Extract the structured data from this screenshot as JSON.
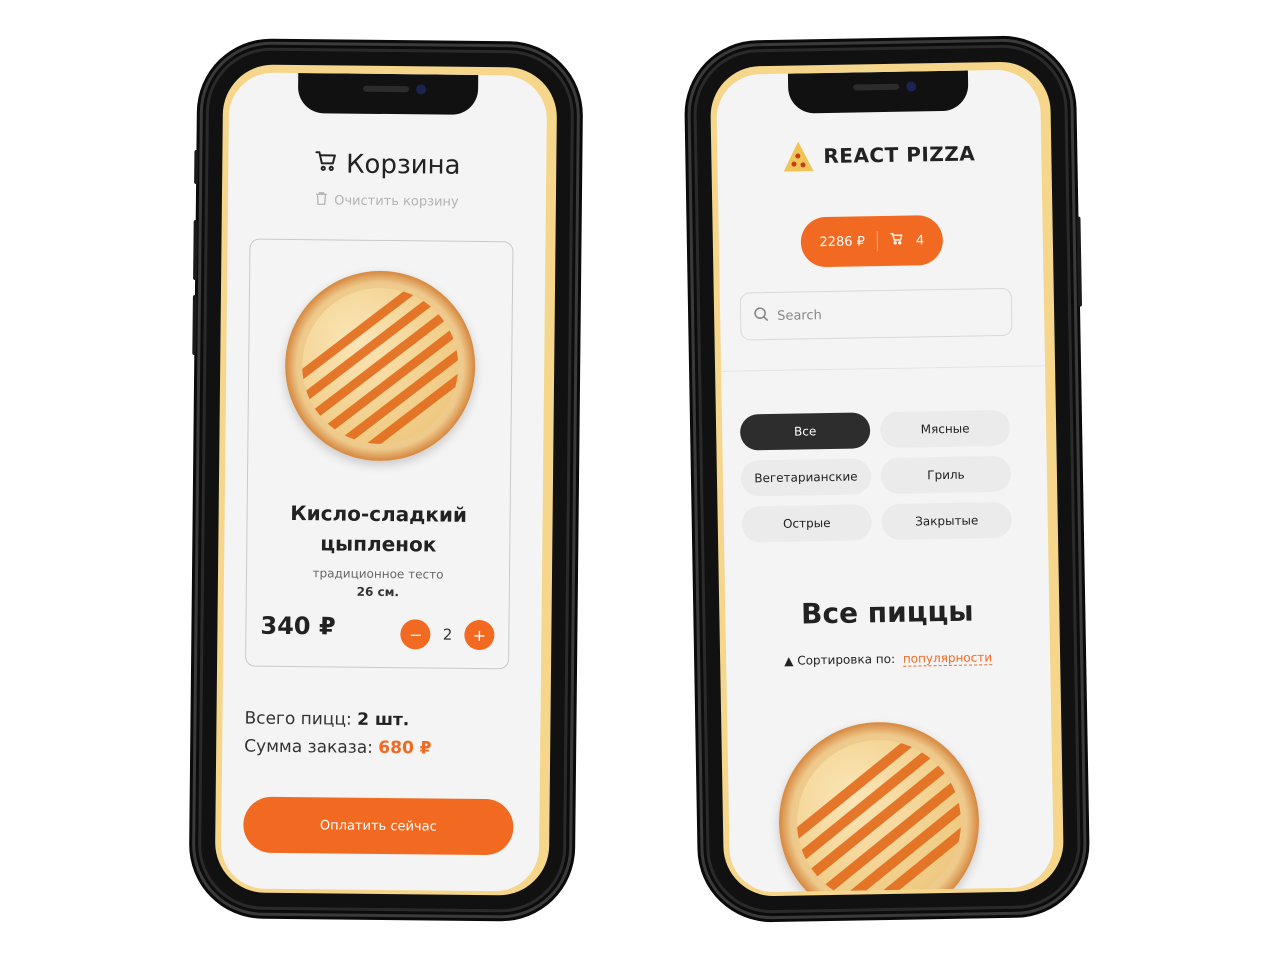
{
  "cart_screen": {
    "title": "Корзина",
    "clear_label": "Очистить корзину",
    "item": {
      "name_line1": "Кисло-сладкий",
      "name_line2": "цыпленок",
      "dough": "традиционное тесто",
      "size": "26 см.",
      "price": "340 ₽",
      "quantity": "2",
      "minus": "−",
      "plus": "+"
    },
    "total_count_label": "Всего пицц:",
    "total_count_value": "2 шт.",
    "total_sum_label": "Сумма заказа:",
    "total_sum_value": "680 ₽",
    "pay_label": "Оплатить сейчас"
  },
  "catalog_screen": {
    "brand": "REACT PIZZA",
    "cart_price": "2286 ₽",
    "cart_count": "4",
    "search_placeholder": "Search",
    "categories": [
      {
        "label": "Все",
        "active": true
      },
      {
        "label": "Мясные",
        "active": false
      },
      {
        "label": "Вегетарианские",
        "active": false
      },
      {
        "label": "Гриль",
        "active": false
      },
      {
        "label": "Острые",
        "active": false
      },
      {
        "label": "Закрытые",
        "active": false
      }
    ],
    "section_title": "Все пиццы",
    "sort_label": "Сортировка по:",
    "sort_value": "популярности"
  },
  "colors": {
    "accent": "#f26a22",
    "dark_chip": "#2d2d2d",
    "frame_yellow": "#f5d68a"
  },
  "icons": [
    "cart-icon",
    "trash-icon",
    "search-icon",
    "pizza-logo-icon",
    "sort-arrow-icon"
  ]
}
